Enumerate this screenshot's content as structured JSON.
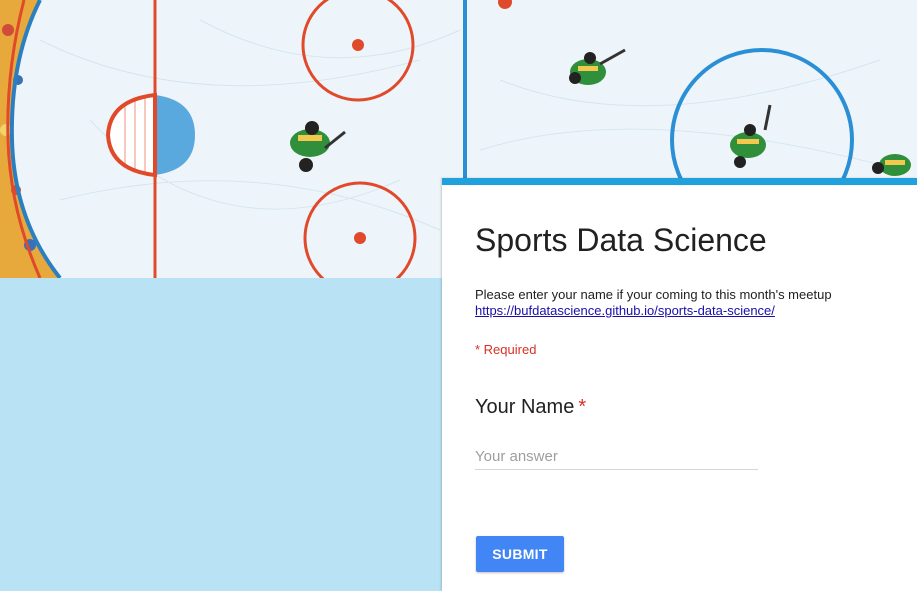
{
  "colors": {
    "page_background": "#b9e2f5",
    "accent": "#1ea1dc",
    "submit_button": "#4285f4",
    "required": "#d93025",
    "link": "#1a0dab"
  },
  "header": {
    "image_subject": "hockey-rink-illustration"
  },
  "form": {
    "title": "Sports Data Science",
    "description": "Please enter your name if your coming to this month's meetup",
    "link": "https://bufdatascience.github.io/sports-data-science/",
    "required_note": "* Required",
    "questions": [
      {
        "title": "Your Name",
        "required_marker": "*",
        "placeholder": "Your answer",
        "value": ""
      }
    ],
    "submit_label": "SUBMIT"
  }
}
